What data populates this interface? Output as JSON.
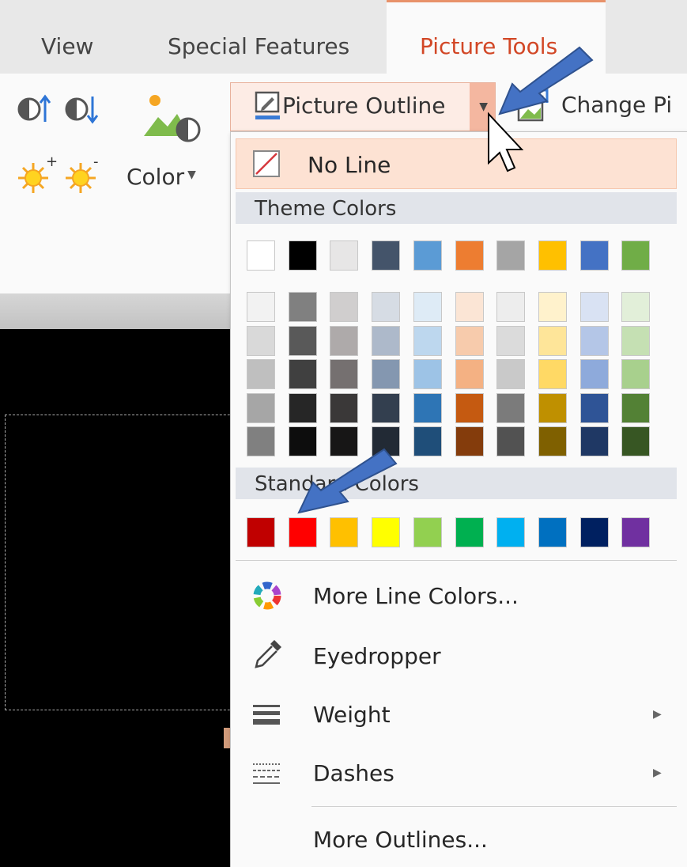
{
  "tabs": {
    "view": "View",
    "special_features": "Special Features",
    "picture_tools": "Picture Tools"
  },
  "ribbon": {
    "color_button": "Color",
    "picture_outline": "Picture Outline",
    "change_picture": "Change Pi"
  },
  "menu": {
    "no_line": "No Line",
    "theme_colors_heading": "Theme Colors",
    "standard_colors_heading": "Standard Colors",
    "more_line_colors": "More Line Colors...",
    "eyedropper": "Eyedropper",
    "weight": "Weight",
    "dashes": "Dashes",
    "more_outlines": "More Outlines..."
  },
  "theme_colors": {
    "top_row": [
      "#ffffff",
      "#000000",
      "#e7e6e6",
      "#44546a",
      "#5b9bd5",
      "#ed7d31",
      "#a5a5a5",
      "#ffc000",
      "#4472c4",
      "#70ad47"
    ],
    "tints": [
      [
        "#f2f2f2",
        "#d9d9d9",
        "#bfbfbf",
        "#a6a6a6",
        "#808080"
      ],
      [
        "#808080",
        "#595959",
        "#404040",
        "#262626",
        "#0d0d0d"
      ],
      [
        "#d0cece",
        "#aeaaaa",
        "#757070",
        "#3a3838",
        "#171616"
      ],
      [
        "#d6dce4",
        "#adb9ca",
        "#8497b0",
        "#333f4f",
        "#222a35"
      ],
      [
        "#deebf6",
        "#bdd7ee",
        "#9dc3e6",
        "#2e75b5",
        "#1f4e79"
      ],
      [
        "#fbe5d5",
        "#f7cbac",
        "#f4b183",
        "#c55a11",
        "#843c0c"
      ],
      [
        "#ededed",
        "#dbdbdb",
        "#c9c9c9",
        "#7b7b7b",
        "#525252"
      ],
      [
        "#fff2cc",
        "#fee599",
        "#ffd965",
        "#bf9000",
        "#7f6000"
      ],
      [
        "#d9e2f3",
        "#b4c6e7",
        "#8eaadb",
        "#2f5496",
        "#1f3864"
      ],
      [
        "#e2efd9",
        "#c5e0b3",
        "#a8d08d",
        "#538135",
        "#375623"
      ]
    ]
  },
  "standard_colors": [
    "#c00000",
    "#ff0000",
    "#ffc000",
    "#ffff00",
    "#92d050",
    "#00b050",
    "#00b0f0",
    "#0070c0",
    "#002060",
    "#7030a0"
  ],
  "accent_colors": {
    "tab_accent": "#d24726",
    "annotation_arrow": "#3f6fb6"
  }
}
